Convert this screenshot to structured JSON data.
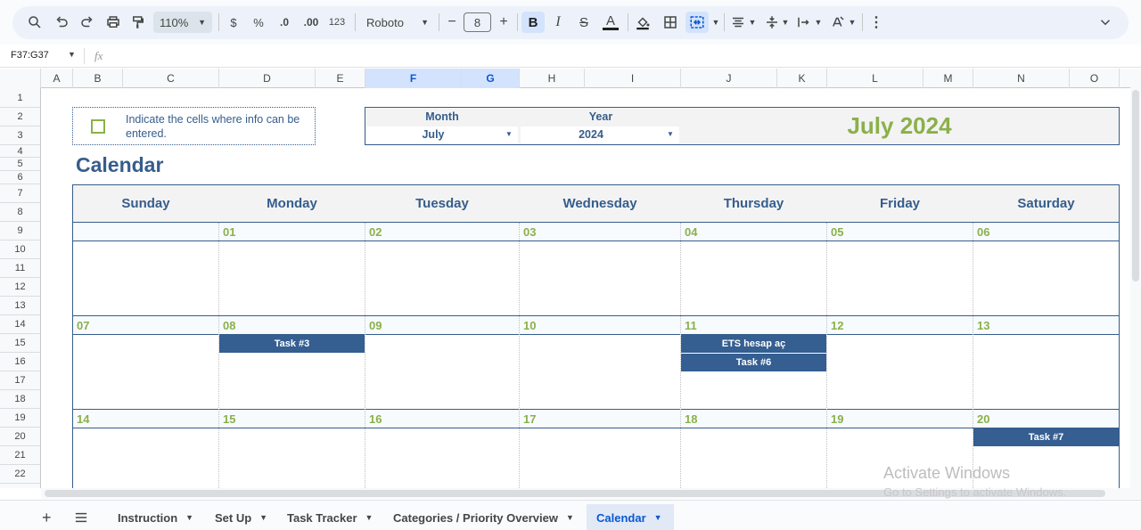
{
  "toolbar": {
    "zoom": "110%",
    "currency": "$",
    "percent": "%",
    "dec_dec": ".0",
    "dec_inc": ".00",
    "number_format": "123",
    "font": "Roboto",
    "font_size": "8",
    "icons": [
      "search-icon",
      "undo-icon",
      "redo-icon",
      "print-icon",
      "paint-format-icon",
      "minus-icon",
      "plus-icon",
      "bold-icon",
      "italic-icon",
      "strikethrough-icon",
      "text-color-icon",
      "fill-color-icon",
      "borders-icon",
      "merge-cells-icon",
      "align-icon",
      "valign-icon",
      "wrap-icon",
      "rotate-icon",
      "more-icon",
      "collapse-icon"
    ]
  },
  "formula_bar": {
    "name_box": "F37:G37",
    "fx": "fx",
    "value": ""
  },
  "columns": [
    "A",
    "B",
    "C",
    "D",
    "E",
    "F",
    "G",
    "H",
    "I",
    "J",
    "K",
    "L",
    "M",
    "N",
    "O"
  ],
  "selected_columns": [
    "F",
    "G"
  ],
  "rows": [
    "1",
    "2",
    "3",
    "4",
    "5",
    "6",
    "7",
    "8",
    "9",
    "10",
    "11",
    "12",
    "13",
    "14",
    "15",
    "16",
    "17",
    "18",
    "19",
    "20",
    "21",
    "22"
  ],
  "sheet": {
    "legend_text": "Indicate the cells where info can be entered.",
    "month_label": "Month",
    "year_label": "Year",
    "month_value": "July",
    "year_value": "2024",
    "heading": "July 2024",
    "title": "Calendar",
    "weekdays": [
      "Sunday",
      "Monday",
      "Tuesday",
      "Wednesday",
      "Thursday",
      "Friday",
      "Saturday"
    ],
    "weeks": [
      [
        "",
        "01",
        "02",
        "03",
        "04",
        "05",
        "06"
      ],
      [
        "07",
        "08",
        "09",
        "10",
        "11",
        "12",
        "13"
      ],
      [
        "14",
        "15",
        "16",
        "17",
        "18",
        "19",
        "20"
      ]
    ],
    "tasks": [
      {
        "week": 1,
        "day": 1,
        "slot": 0,
        "label": "Task #3"
      },
      {
        "week": 1,
        "day": 4,
        "slot": 0,
        "label": "ETS hesap aç"
      },
      {
        "week": 1,
        "day": 4,
        "slot": 1,
        "label": "Task #6"
      },
      {
        "week": 2,
        "day": 6,
        "slot": 0,
        "label": "Task #7"
      }
    ]
  },
  "watermark": {
    "line1": "Activate Windows",
    "line2": "Go to Settings to activate Windows."
  },
  "tabs": [
    "Instruction",
    "Set Up",
    "Task Tracker",
    "Categories / Priority Overview",
    "Calendar"
  ],
  "active_tab": "Calendar",
  "colors": {
    "accent_blue": "#365d8c",
    "accent_green": "#8bb04a",
    "task_fill": "#355e91",
    "selection": "#d3e3fd"
  }
}
